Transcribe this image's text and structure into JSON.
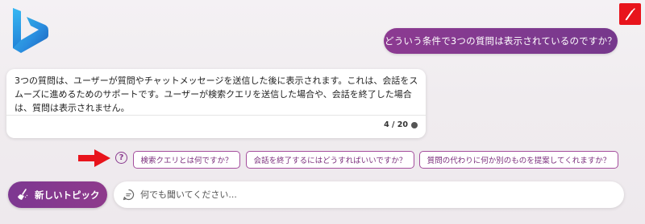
{
  "user_message": {
    "text": "どういう条件で3つの質問は表示されているのですか？"
  },
  "bot_message": {
    "text": "3つの質問は、ユーザーが質問やチャットメッセージを送信した後に表示されます。これは、会話をスムーズに進めるためのサポートです。ユーザーが検索クエリを送信した場合や、会話を終了した場合は、質問は表示されません。",
    "turn_counter": "4 / 20"
  },
  "suggestions": [
    {
      "label": "検索クエリとは何ですか？"
    },
    {
      "label": "会話を終了するにはどうすればいいですか？"
    },
    {
      "label": "質問の代わりに何か別のものを提案してくれますか？"
    }
  ],
  "new_topic_button": {
    "label": "新しいトピック"
  },
  "chat_input": {
    "placeholder": "何でも聞いてください..."
  },
  "icons": {
    "logo": "bing-logo",
    "corner": "red-pen-icon",
    "help": "question-circle-icon",
    "annotation": "red-arrow",
    "new_topic": "broom-icon",
    "chat": "chat-bubble-icon"
  },
  "colors": {
    "accent": "#8c3a91",
    "chip_border": "#a44e9d",
    "chip_text": "#7b2f7d",
    "annotation_red": "#e8141c"
  }
}
